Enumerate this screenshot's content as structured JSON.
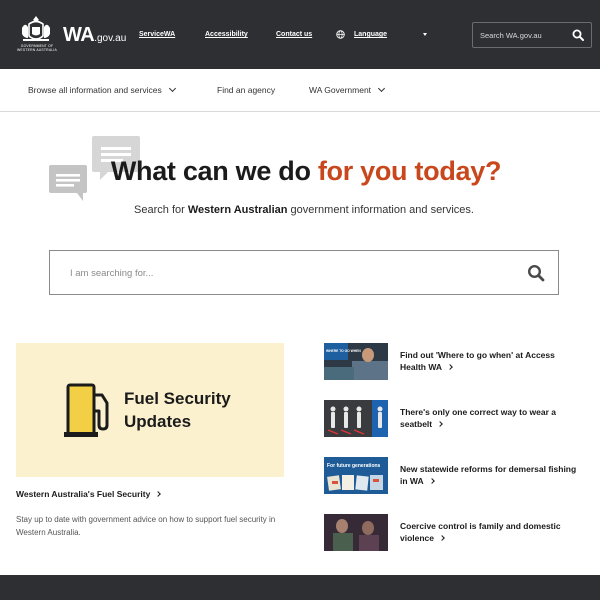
{
  "header": {
    "crest_caption": "GOVERNMENT OF WESTERN AUSTRALIA",
    "logo_main": "WA",
    "logo_suffix": ".gov.au",
    "links": [
      "ServiceWA",
      "Accessibility",
      "Contact us"
    ],
    "language_label": "Language",
    "search_placeholder": "Search WA.gov.au"
  },
  "nav": {
    "items": [
      "Browse all information and services",
      "Find an agency",
      "WA Government"
    ]
  },
  "hero": {
    "title_plain": "What can we do ",
    "title_accent": "for you today?",
    "subtitle_pre": "Search for ",
    "subtitle_bold": "Western Australian",
    "subtitle_post": " government information and services.",
    "search_placeholder": "I am searching for..."
  },
  "feature": {
    "image_title": "Fuel Security Updates",
    "link": "Western Australia's Fuel Security",
    "description": "Stay up to date with government advice on how to support fuel security in Western Australia."
  },
  "news": [
    {
      "text": "Find out 'Where to go when' at Access Health WA"
    },
    {
      "text": "There's only one correct way to wear a seatbelt"
    },
    {
      "text": "New statewide reforms for demersal fishing in WA"
    },
    {
      "text": "Coercive control is family and domestic violence"
    }
  ],
  "thumb_text": {
    "news1": "WHERE TO GO WHEN",
    "news3": "For future generations"
  },
  "colors": {
    "topbar_bg": "#2e2f33",
    "accent_orange": "#c8471c",
    "feature_bg": "#fbf1cf",
    "pump_yellow": "#f2cf45"
  }
}
